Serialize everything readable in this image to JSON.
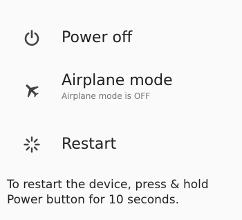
{
  "menu": {
    "items": [
      {
        "icon": "power-icon",
        "label": "Power off"
      },
      {
        "icon": "airplane-icon",
        "label": "Airplane mode",
        "sublabel": "Airplane mode is OFF"
      },
      {
        "icon": "restart-spinner-icon",
        "label": "Restart"
      }
    ]
  },
  "hint": {
    "line1": "To restart the device, press & hold",
    "line2": "Power button for 10 seconds."
  },
  "colors": {
    "icon": "#424242",
    "text": "#212121",
    "subtext": "#757575",
    "background": "#fafafa"
  }
}
